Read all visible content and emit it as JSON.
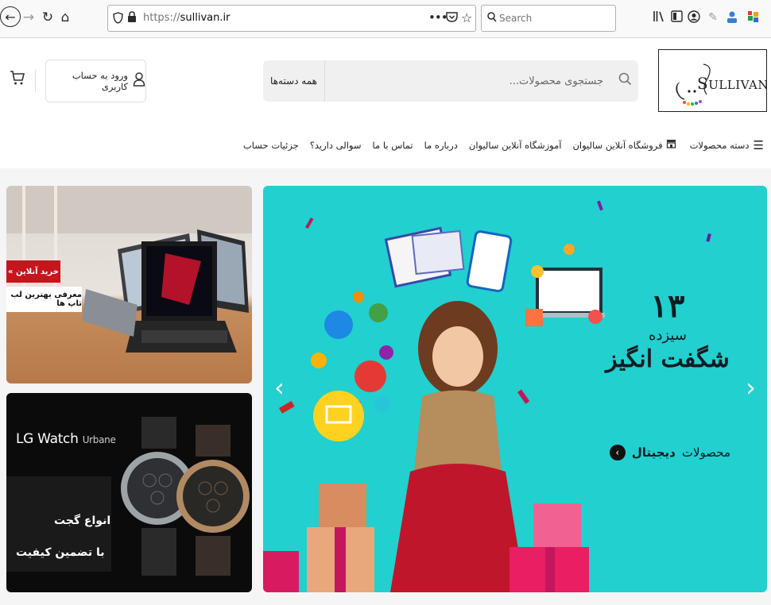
{
  "browser": {
    "back_icon": "back-arrow-icon",
    "forward_icon": "forward-arrow-icon",
    "reload_icon": "reload-icon",
    "home_icon": "home-icon",
    "url_scheme": "https://",
    "url_host": "sullivan.ir",
    "search_placeholder": "Search",
    "toolbar_icons": [
      "library-icon",
      "sidebar-icon",
      "account-icon",
      "pen-icon",
      "profile-icon",
      "extension-icon"
    ]
  },
  "header": {
    "logo_text": "ULLIVAN",
    "logo_letter": "S",
    "search_placeholder": "جستجوی محصولات...",
    "search_category": "همه دسته‌ها",
    "login_label": "ورود به حساب کاربری"
  },
  "nav": {
    "categories_label": "دسته محصولات",
    "items": [
      {
        "label": "فروشگاه آنلاین سالیوان"
      },
      {
        "label": "آموزشگاه آنلاین سالیوان"
      },
      {
        "label": "درباره ما"
      },
      {
        "label": "تماس با ما"
      },
      {
        "label": "سوالی دارید؟"
      },
      {
        "label": "جزئیات حساب"
      }
    ]
  },
  "hero": {
    "number": "۱۳",
    "subtitle1": "سیزده",
    "subtitle2": "شگفت انگیز",
    "cta_prefix": "محصولات",
    "cta_bold": "دیجیتال",
    "colors": {
      "background": "#21d0cf"
    }
  },
  "banners": {
    "laptop": {
      "tag": "خرید آنلاین »",
      "caption": "معرفی بهترین لب تاپ ها"
    },
    "watch": {
      "brand": "LG Watch",
      "model": "Urbane",
      "line1": "انواع گجت",
      "line2": "با تضمین کیفیت"
    }
  }
}
